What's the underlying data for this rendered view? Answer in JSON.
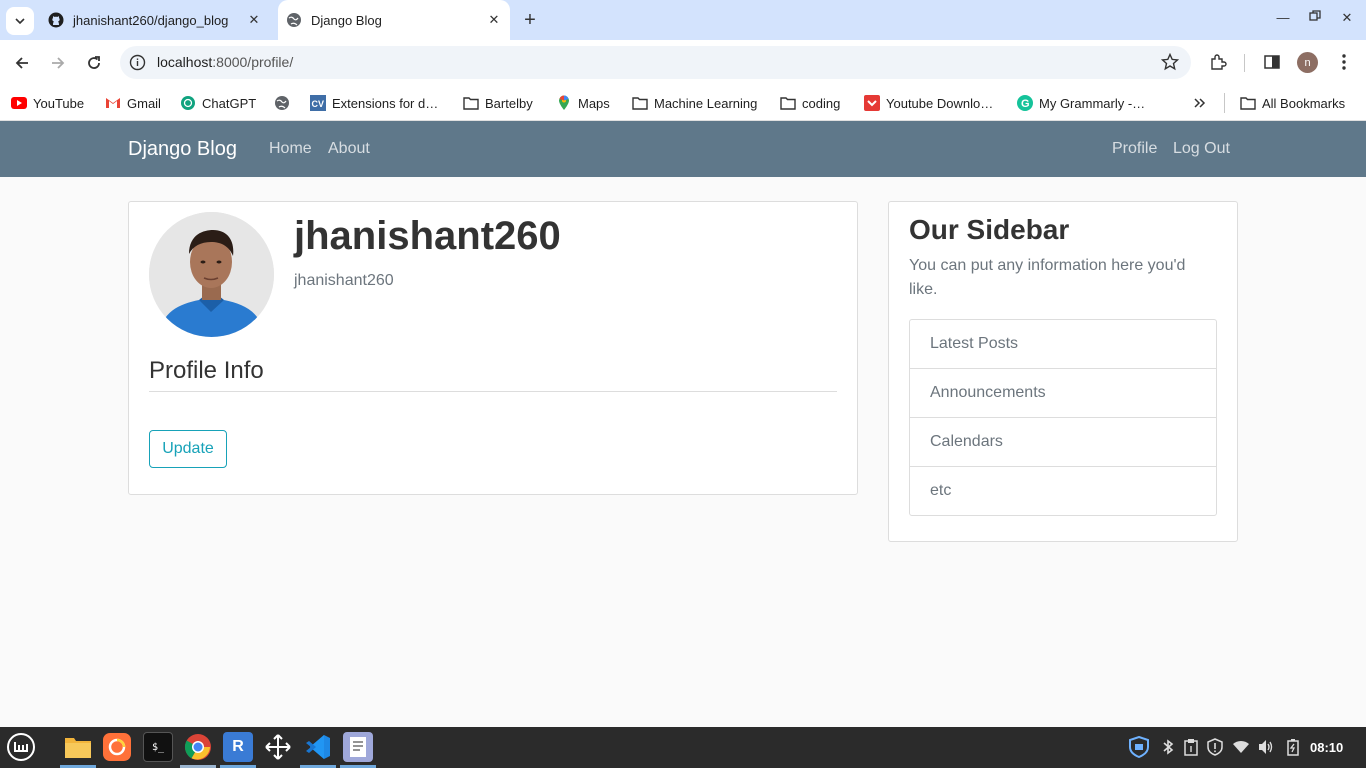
{
  "browser": {
    "tabs": [
      {
        "title": "jhanishant260/django_blog",
        "icon": "github-icon"
      },
      {
        "title": "Django Blog",
        "icon": "globe-icon",
        "active": true
      }
    ],
    "url_host": "localhost",
    "url_path": ":8000/profile/",
    "avatar_letter": "n",
    "bookmarks": [
      {
        "label": "YouTube",
        "icon": "youtube-icon"
      },
      {
        "label": "Gmail",
        "icon": "gmail-icon"
      },
      {
        "label": "ChatGPT",
        "icon": "chatgpt-icon"
      },
      {
        "label": "",
        "icon": "globe-icon"
      },
      {
        "label": "Extensions for d…",
        "icon": "cv-icon"
      },
      {
        "label": "Bartelby",
        "icon": "folder-icon"
      },
      {
        "label": "Maps",
        "icon": "maps-icon"
      },
      {
        "label": "Machine Learning",
        "icon": "folder-icon"
      },
      {
        "label": "coding",
        "icon": "folder-icon"
      },
      {
        "label": "Youtube Downlo…",
        "icon": "youtube-downloader-icon"
      },
      {
        "label": "My Grammarly -…",
        "icon": "grammarly-icon"
      },
      {
        "label": "All Bookmarks",
        "icon": "folder-icon"
      }
    ]
  },
  "site": {
    "brand": "Django Blog",
    "nav_left": [
      "Home",
      "About"
    ],
    "nav_right": [
      "Profile",
      "Log Out"
    ],
    "colors": {
      "navbar": "#5f788a",
      "accent": "#17a2b8"
    }
  },
  "profile": {
    "username": "jhanishant260",
    "email": "jhanishant260",
    "legend": "Profile Info",
    "update_label": "Update"
  },
  "sidebar": {
    "title": "Our Sidebar",
    "text": "You can put any information here you'd like.",
    "items": [
      "Latest Posts",
      "Announcements",
      "Calendars",
      "etc"
    ]
  },
  "taskbar": {
    "clock": "08:10",
    "apps": [
      "mint-menu-icon",
      "files-icon",
      "firefox-icon",
      "terminal-icon",
      "chrome-icon",
      "vnc-icon",
      "move-tool-icon",
      "vscode-icon",
      "text-editor-icon"
    ]
  }
}
